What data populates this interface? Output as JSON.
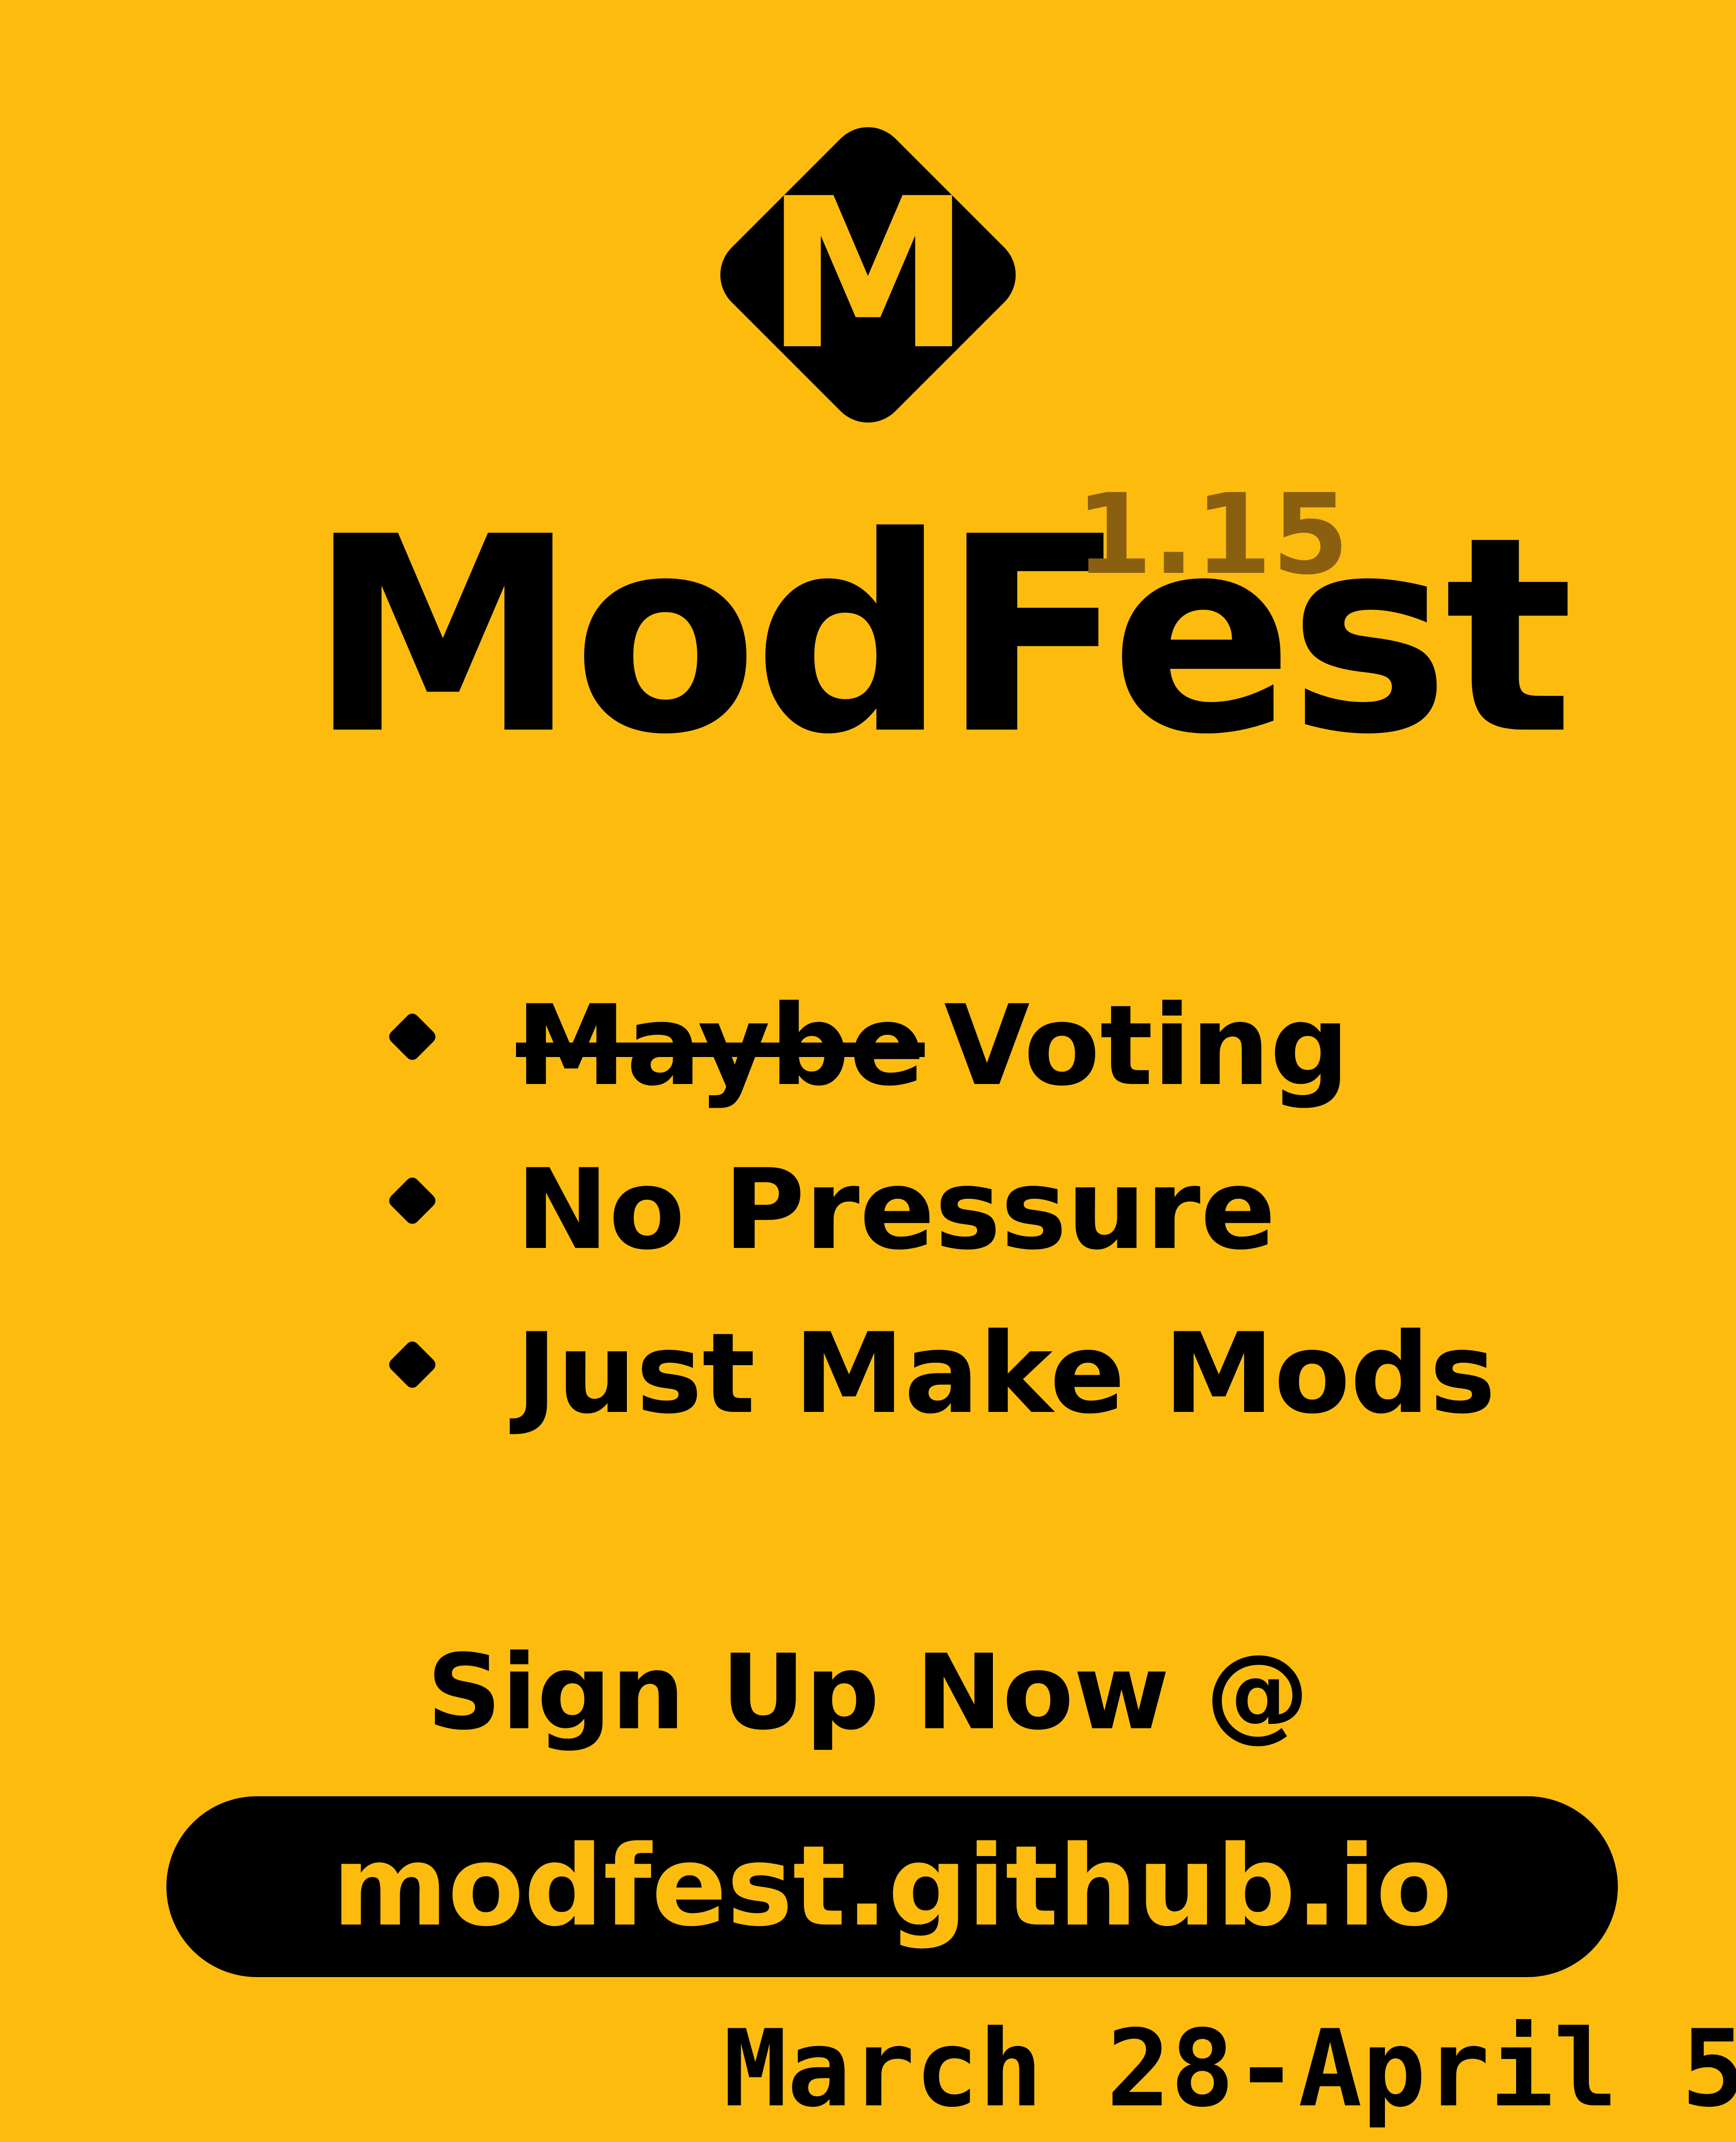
{
  "logo": {
    "icon": "modfest-diamond-logo",
    "letter": "M"
  },
  "title": "ModFest",
  "version": "1.15",
  "features": [
    {
      "struck": "Maybe",
      "text": "Voting"
    },
    {
      "struck": "",
      "text": "No Pressure"
    },
    {
      "struck": "",
      "text": "Just Make Mods"
    }
  ],
  "signup": {
    "label": "Sign Up Now @",
    "url": "modfest.github.io"
  },
  "dates": "March 28-April 5",
  "colors": {
    "background": "#FDBC0D",
    "foreground": "#000000",
    "version": "#8A5F10"
  }
}
